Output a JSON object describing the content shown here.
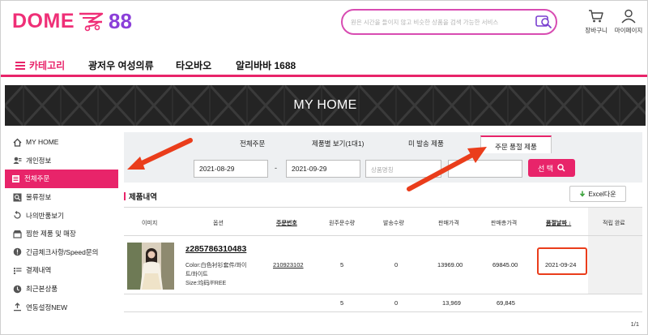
{
  "header": {
    "logo_text": "DOME",
    "logo_number": "88",
    "search_placeholder": "원은 시간을 들이지 않고 비슷한 상품을 검색 가능한 서비스",
    "cart_label": "장바구니",
    "mypage_label": "마이페이지"
  },
  "nav": {
    "category_label": "카테고리",
    "items": [
      "광저우 여성의류",
      "타오바오",
      "알리바바 1688"
    ]
  },
  "banner": {
    "title": "MY HOME"
  },
  "sidebar": {
    "items": [
      {
        "label": "MY HOME",
        "icon": "home-icon"
      },
      {
        "label": "개인정보",
        "icon": "user-card-icon"
      },
      {
        "label": "전체주문",
        "icon": "order-list-icon",
        "active": true
      },
      {
        "label": "물류정보",
        "icon": "search-box-icon"
      },
      {
        "label": "나의반품보기",
        "icon": "return-icon"
      },
      {
        "label": "찜한 제품 및 매장",
        "icon": "store-icon"
      },
      {
        "label": "긴급체크사항/Speed문의",
        "icon": "alert-icon"
      },
      {
        "label": "결제내역",
        "icon": "payment-icon"
      },
      {
        "label": "최근본상품",
        "icon": "clock-icon"
      },
      {
        "label": "연동설정NEW",
        "icon": "upload-icon"
      }
    ]
  },
  "tabs": {
    "items": [
      "전체주문",
      "제품별 보기(1대1)",
      "미 발송 제품",
      "주문 품절 제품"
    ],
    "active": "주문 품절 제품"
  },
  "filter": {
    "date_from": "2021-08-29",
    "date_separator": "-",
    "date_to": "2021-09-29",
    "product_placeholder": "상품명칭",
    "select_button": "선 택"
  },
  "section": {
    "title": "제품내역",
    "excel_button": "Excel다운"
  },
  "table": {
    "headers": [
      "이미지",
      "옵션",
      "주문번호",
      "원주문수량",
      "발송수량",
      "판매가격",
      "판매총가격",
      "품절날짜 ↓",
      "적립 완료"
    ],
    "rows": [
      {
        "product_code": "z285786310483",
        "option_lines": [
          "Color:白色衬衫套件/화이",
          "트/화이트",
          "Size:均码/FREE"
        ],
        "order_no": "210923102",
        "orig_qty": "5",
        "shipped_qty": "0",
        "price": "13969.00",
        "total_price": "69845.00",
        "soldout_date": "2021-09-24"
      }
    ],
    "totals": {
      "orig_qty": "5",
      "shipped_qty": "0",
      "price": "13,969",
      "total_price": "69,845"
    }
  },
  "pager": "1/1",
  "colors": {
    "brand_pink": "#e8246a",
    "brand_purple": "#8b3fd9",
    "annotation_red": "#ea3d1b"
  }
}
